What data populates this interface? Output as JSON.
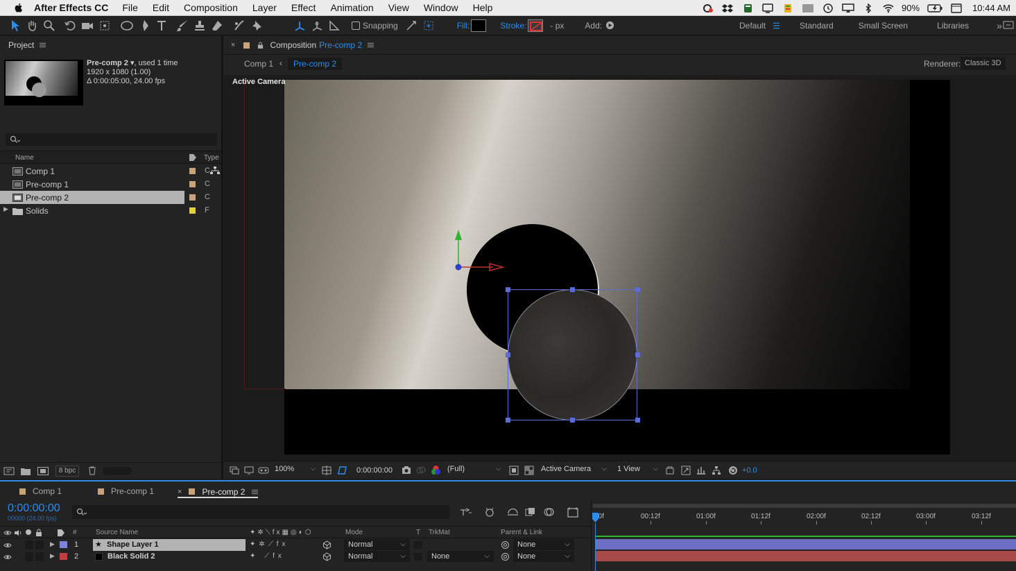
{
  "menubar": {
    "app_name": "After Effects CC",
    "items": [
      "File",
      "Edit",
      "Composition",
      "Layer",
      "Effect",
      "Animation",
      "View",
      "Window",
      "Help"
    ],
    "battery": "90%",
    "clock": "10:44 AM"
  },
  "toolbar": {
    "snapping_label": "Snapping",
    "fill_label": "Fill:",
    "stroke_label": "Stroke:",
    "stroke_width": "- px",
    "add_label": "Add:",
    "workspaces": [
      "Default",
      "Standard",
      "Small Screen",
      "Libraries"
    ],
    "more": "»"
  },
  "project": {
    "title": "Project",
    "selected_name": "Pre-comp 2",
    "selected_usage": ", used 1 time",
    "selected_size": "1920 x 1080 (1.00)",
    "selected_duration": "Δ 0:00:05:00, 24.00 fps",
    "col_name": "Name",
    "col_type": "Type",
    "items": [
      {
        "name": "Comp 1",
        "type": "C",
        "color": "#c7a27a"
      },
      {
        "name": "Pre-comp 1",
        "type": "C",
        "color": "#c7a27a"
      },
      {
        "name": "Pre-comp 2",
        "type": "C",
        "color": "#c7a27a"
      },
      {
        "name": "Solids",
        "type": "F",
        "color": "#e3d33a"
      }
    ],
    "bpc": "8 bpc"
  },
  "comp": {
    "tab_prefix": "Composition",
    "tab_name": "Pre-comp 2",
    "crumbs": [
      "Comp 1",
      "Pre-comp 2"
    ],
    "renderer_label": "Renderer:",
    "renderer_value": "Classic 3D",
    "view_label": "Active Camera",
    "zoom": "100%",
    "timecode": "0:00:00:00",
    "resolution": "(Full)",
    "camera": "Active Camera",
    "views": "1 View",
    "exposure": "+0.0"
  },
  "timeline": {
    "tabs": [
      "Comp 1",
      "Pre-comp 1",
      "Pre-comp 2"
    ],
    "timecode": "0:00:00:00",
    "frames": "00000 (24.00 fps)",
    "col_num": "#",
    "col_source": "Source Name",
    "col_mode": "Mode",
    "col_t": "T",
    "col_trkmat": "TrkMat",
    "col_parent": "Parent & Link",
    "layers": [
      {
        "num": "1",
        "name": "Shape Layer 1",
        "mode": "Normal",
        "trkmat": "",
        "parent": "None",
        "label_color": "#7c83d9",
        "bar_color": "#6c6fc4"
      },
      {
        "num": "2",
        "name": "Black Solid 2",
        "mode": "Normal",
        "trkmat": "None",
        "parent": "None",
        "label_color": "#c04040",
        "bar_color": "#a94a4a"
      }
    ],
    "ruler": [
      "00f",
      "00:12f",
      "01:00f",
      "01:12f",
      "02:00f",
      "02:12f",
      "03:00f",
      "03:12f"
    ]
  }
}
